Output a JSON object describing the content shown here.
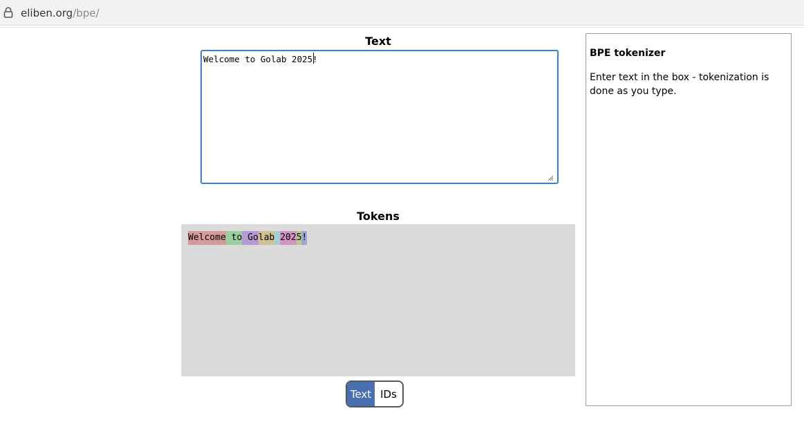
{
  "browser": {
    "url_host": "eliben.org",
    "url_path": "/bpe/"
  },
  "main": {
    "text_heading": "Text",
    "input_value": "Welcome to Golab 2025!",
    "tokens_heading": "Tokens",
    "tokens": [
      {
        "text": "Welcome",
        "color": "#d59a9a"
      },
      {
        "text": " to",
        "color": "#99d19e"
      },
      {
        "text": " Go",
        "color": "#b59ad6"
      },
      {
        "text": "lab",
        "color": "#d2c190"
      },
      {
        "text": " ",
        "color": "#9fd3d3"
      },
      {
        "text": "202",
        "color": "#d393c7"
      },
      {
        "text": "5",
        "color": "#b7cf8c"
      },
      {
        "text": "!",
        "color": "#9aa8d8"
      }
    ],
    "toggle": {
      "text_label": "Text",
      "ids_label": "IDs",
      "active": "Text",
      "active_color": "#4a6fb0"
    }
  },
  "sidebar": {
    "title": "BPE tokenizer",
    "description": "Enter text in the box - tokenization is done as you type."
  }
}
